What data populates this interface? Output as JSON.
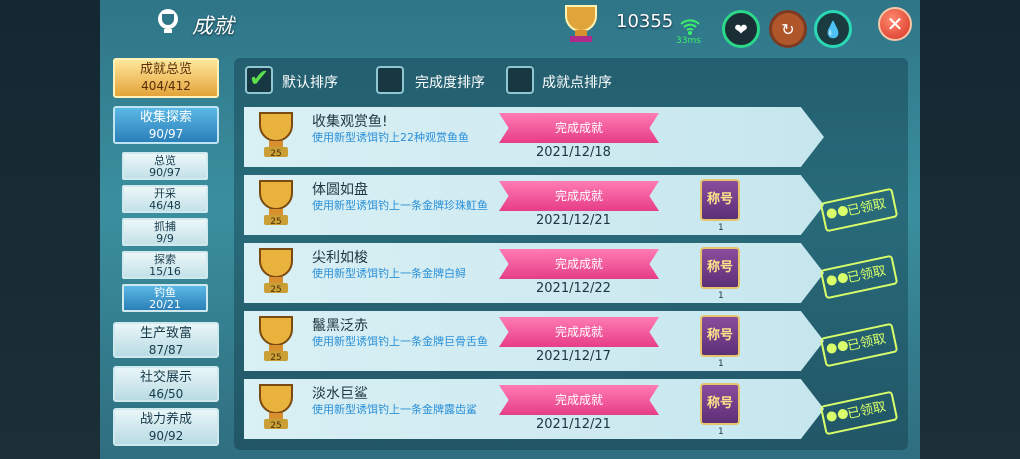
{
  "header": {
    "title": "成就",
    "coins": "10355",
    "ping": "33ms"
  },
  "sidebar": {
    "overview": {
      "label": "成就总览",
      "value": "404/412"
    },
    "collect": {
      "label": "收集探索",
      "value": "90/97"
    },
    "subs": [
      {
        "label": "总览",
        "value": "90/97"
      },
      {
        "label": "开采",
        "value": "46/48"
      },
      {
        "label": "抓捕",
        "value": "9/9"
      },
      {
        "label": "探索",
        "value": "15/16"
      },
      {
        "label": "钓鱼",
        "value": "20/21"
      }
    ],
    "cats": [
      {
        "label": "生产致富",
        "value": "87/87"
      },
      {
        "label": "社交展示",
        "value": "46/50"
      },
      {
        "label": "战力养成",
        "value": "90/92"
      }
    ]
  },
  "sort": {
    "default": "默认排序",
    "completion": "完成度排序",
    "points": "成就点排序"
  },
  "achievements": [
    {
      "name": "收集观赏鱼!",
      "desc": "使用新型诱饵钓上22种观赏鱼鱼",
      "status": "完成成就",
      "date": "2021/12/18",
      "points": "25"
    },
    {
      "name": "体圆如盘",
      "desc": "使用新型诱饵钓上一条金牌珍珠魟鱼",
      "status": "完成成就",
      "date": "2021/12/21",
      "points": "25",
      "reward": "称号",
      "reward_count": "1",
      "claimed": "已领取"
    },
    {
      "name": "尖利如梭",
      "desc": "使用新型诱饵钓上一条金牌白鲟",
      "status": "完成成就",
      "date": "2021/12/22",
      "points": "25",
      "reward": "称号",
      "reward_count": "1",
      "claimed": "已领取"
    },
    {
      "name": "鬣黑泛赤",
      "desc": "使用新型诱饵钓上一条金牌巨骨舌鱼",
      "status": "完成成就",
      "date": "2021/12/17",
      "points": "25",
      "reward": "称号",
      "reward_count": "1",
      "claimed": "已领取"
    },
    {
      "name": "淡水巨鲨",
      "desc": "使用新型诱饵钓上一条金牌露齿鲨",
      "status": "完成成就",
      "date": "2021/12/21",
      "points": "25",
      "reward": "称号",
      "reward_count": "1",
      "claimed": "已领取"
    }
  ]
}
